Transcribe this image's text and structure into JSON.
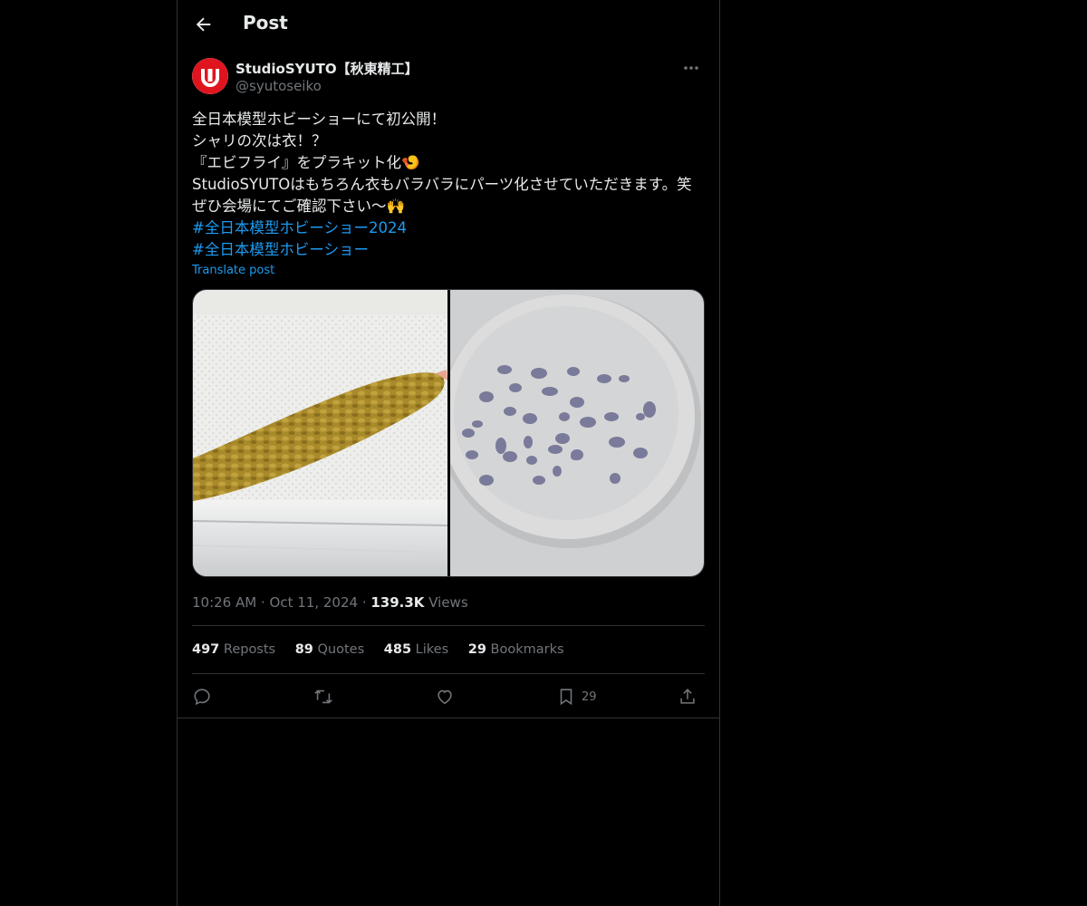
{
  "header": {
    "title": "Post"
  },
  "author": {
    "display_name": "StudioSYUTO【秋東精工】",
    "handle": "@syutoseiko",
    "brand_color": "#e0141e"
  },
  "post": {
    "lines": [
      "全日本模型ホビーショーにて初公開！",
      "シャリの次は衣！？",
      "『エビフライ』をプラキット化🍤",
      "StudioSYUTOはもちろん衣もバラバラにパーツ化させていただきます。笑",
      "ぜひ会場にてご確認下さい〜🙌"
    ],
    "hashtags": [
      "#全日本模型ホビーショー2024",
      "#全日本模型ホビーショー"
    ],
    "translate_label": "Translate post"
  },
  "meta": {
    "time": "10:26 AM",
    "date": "Oct 11, 2024",
    "views_count": "139.3K",
    "views_label": "Views"
  },
  "stats": {
    "reposts_count": "497",
    "reposts_label": "Reposts",
    "quotes_count": "89",
    "quotes_label": "Quotes",
    "likes_count": "485",
    "likes_label": "Likes",
    "bookmarks_count": "29",
    "bookmarks_label": "Bookmarks"
  },
  "actions": {
    "icons": [
      "reply-icon",
      "repost-icon",
      "like-icon",
      "bookmark-icon",
      "share-icon"
    ],
    "bookmark_count": "29"
  },
  "colors": {
    "accent": "#1d9bf0",
    "secondary_text": "#71767b",
    "border": "#2f3336"
  }
}
